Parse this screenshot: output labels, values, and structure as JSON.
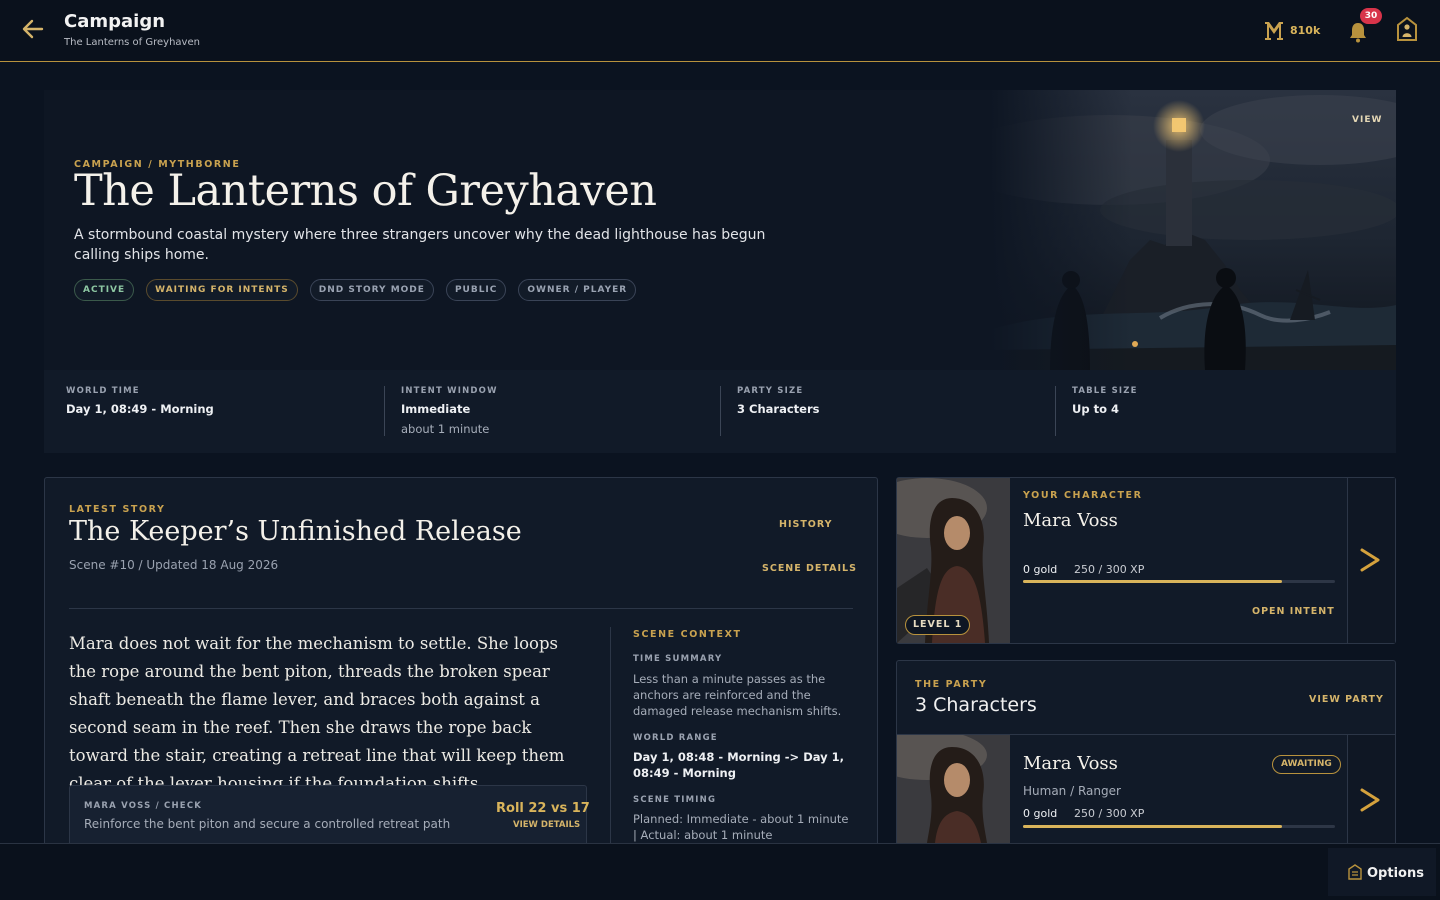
{
  "header": {
    "title": "Campaign",
    "subtitle": "The Lanterns of Greyhaven",
    "currency_value": "810k",
    "notification_count": "30",
    "accent": "#c9a24f"
  },
  "hero": {
    "kicker": "CAMPAIGN / MYTHBORNE",
    "title": "The Lanterns of Greyhaven",
    "description": "A stormbound coastal mystery where three strangers uncover why the dead lighthouse has begun calling ships home.",
    "tags": [
      "ACTIVE",
      "WAITING FOR INTENTS",
      "DND STORY MODE",
      "PUBLIC",
      "OWNER / PLAYER"
    ],
    "view_label": "VIEW"
  },
  "stats": [
    {
      "label": "WORLD TIME",
      "value": "Day 1, 08:49 - Morning",
      "sub": ""
    },
    {
      "label": "INTENT WINDOW",
      "value": "Immediate",
      "sub": "about 1 minute"
    },
    {
      "label": "PARTY SIZE",
      "value": "3 Characters",
      "sub": ""
    },
    {
      "label": "TABLE SIZE",
      "value": "Up to 4",
      "sub": ""
    }
  ],
  "story": {
    "kicker": "LATEST STORY",
    "title": "The Keeper’s Unfinished Release",
    "meta": "Scene #10 / Updated 18 Aug 2026",
    "history_label": "HISTORY",
    "scene_details_label": "SCENE DETAILS",
    "body": "Mara does not wait for the mechanism to settle. She loops the rope around the bent piton, threads the broken spear shaft beneath the flame lever, and braces both against a second seam in the reef. Then she draws the rope back toward the stair, creating a retreat line that will keep them clear of the lever housing if the foundation shifts.",
    "check": {
      "label": "MARA VOSS / CHECK",
      "text": "Reinforce the bent piton and secure a controlled retreat path",
      "roll": "Roll 22 vs 17",
      "details_label": "VIEW DETAILS"
    }
  },
  "scene_context": {
    "kicker": "SCENE CONTEXT",
    "time_summary_label": "TIME SUMMARY",
    "time_summary": "Less than a minute passes as the anchors are reinforced and the damaged release mechanism shifts.",
    "world_range_label": "WORLD RANGE",
    "world_range": "Day 1, 08:48 - Morning -> Day 1, 08:49 - Morning",
    "scene_timing_label": "SCENE TIMING",
    "planned": "Planned: Immediate - about 1 minute",
    "actual": "|   Actual: about 1 minute"
  },
  "your_character": {
    "kicker": "YOUR CHARACTER",
    "name": "Mara Voss",
    "level": "LEVEL 1",
    "gold": "0 gold",
    "xp": "250 / 300 XP",
    "xp_progress": 0.83,
    "open_intent_label": "OPEN INTENT"
  },
  "party": {
    "kicker": "THE PARTY",
    "count": "3 Characters",
    "view_party_label": "VIEW PARTY",
    "members": [
      {
        "name": "Mara Voss",
        "status": "AWAITING",
        "race_class": "Human / Ranger",
        "gold": "0 gold",
        "xp": "250 / 300 XP",
        "xp_progress": 0.83
      }
    ]
  },
  "footer": {
    "options_label": "Options"
  }
}
